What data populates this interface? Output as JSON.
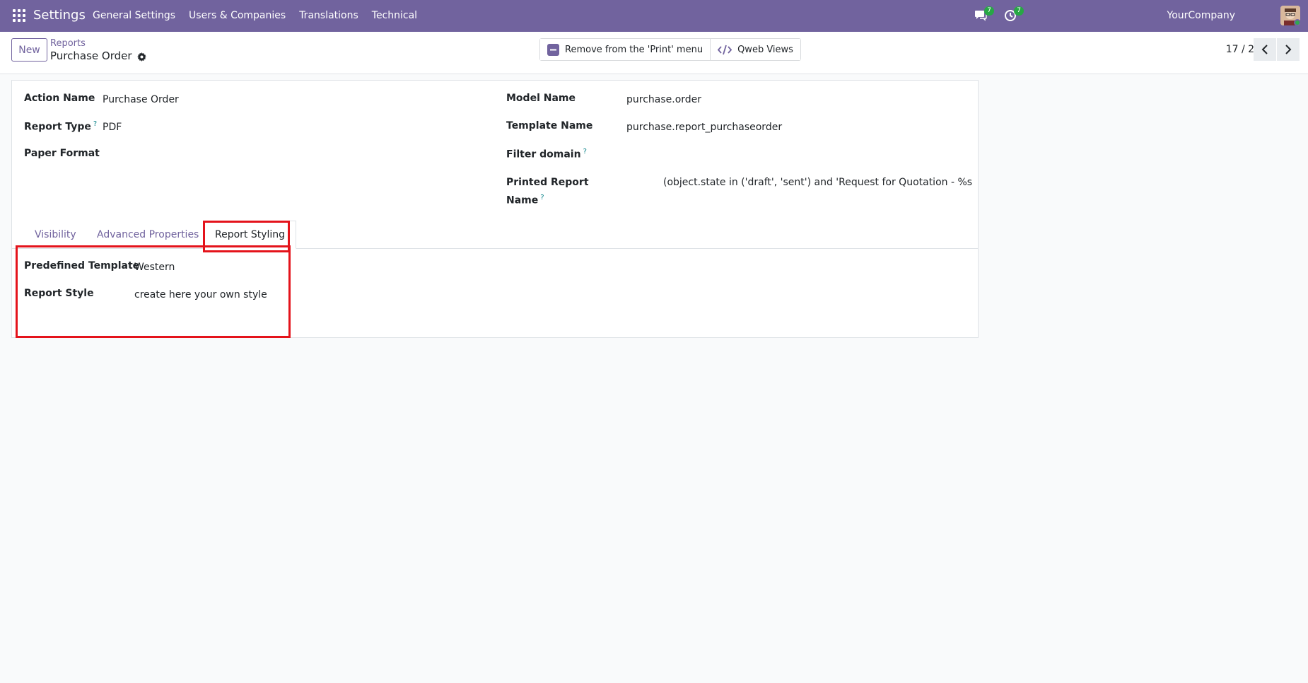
{
  "topbar": {
    "app_title": "Settings",
    "menu": [
      "General Settings",
      "Users & Companies",
      "Translations",
      "Technical"
    ],
    "chat_badge": "7",
    "activity_badge": "7",
    "company": "YourCompany"
  },
  "control": {
    "new_label": "New",
    "breadcrumb_parent": "Reports",
    "breadcrumb_current": "Purchase Order",
    "actions": [
      "Remove from the 'Print' menu",
      "Qweb Views"
    ],
    "pager": "17 / 22"
  },
  "form": {
    "action_name": {
      "label": "Action Name",
      "value": "Purchase Order"
    },
    "report_type": {
      "label": "Report Type",
      "help": "?",
      "value": "PDF"
    },
    "paper_format": {
      "label": "Paper Format",
      "value": ""
    },
    "model_name": {
      "label": "Model Name",
      "value": "purchase.order"
    },
    "template_name": {
      "label": "Template Name",
      "value": "purchase.report_purchaseorder"
    },
    "filter_domain": {
      "label": "Filter domain",
      "help": "?",
      "value": ""
    },
    "printed_report_name": {
      "label_line1": "Printed Report",
      "label_line2": "Name",
      "help": "?",
      "value": "(object.state in ('draft', 'sent') and 'Request for Quotation - %s"
    }
  },
  "tabs": [
    "Visibility",
    "Advanced Properties",
    "Report Styling"
  ],
  "active_tab": "Report Styling",
  "styling": {
    "predefined_template": {
      "label": "Predefined Template",
      "value": "Western"
    },
    "report_style": {
      "label": "Report Style",
      "value": "create here your own style"
    }
  },
  "colors": {
    "brand": "#71639e",
    "highlight": "#e4131b",
    "badge": "#27a745"
  }
}
